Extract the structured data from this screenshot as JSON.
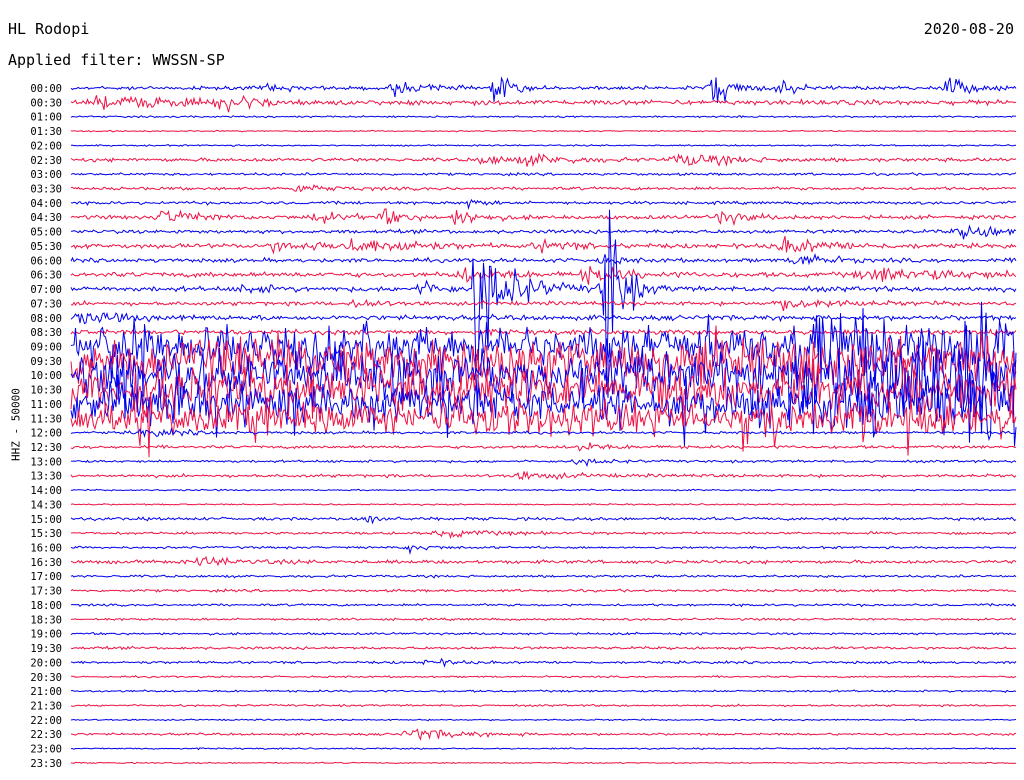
{
  "header": {
    "station": "HL Rodopi",
    "date": "2020-08-20",
    "filter_prefix": "Applied filter:",
    "filter_name": "WWSSN-SP"
  },
  "channel_label": "HHZ - 50000",
  "colors": {
    "odd_trace": "#0000ee",
    "even_trace": "#ee1144",
    "text": "#000000",
    "background": "#ffffff"
  },
  "chart_data": {
    "type": "line",
    "title": "",
    "xlabel": "",
    "ylabel": "HHZ - 50000",
    "grid": false,
    "legend": "none",
    "y_tick_labels": [
      "00:00",
      "00:30",
      "01:00",
      "01:30",
      "02:00",
      "02:30",
      "03:00",
      "03:30",
      "04:00",
      "04:30",
      "05:00",
      "05:30",
      "06:00",
      "06:30",
      "07:00",
      "07:30",
      "08:00",
      "08:30",
      "09:00",
      "09:30",
      "10:00",
      "10:30",
      "11:00",
      "11:30",
      "12:00",
      "12:30",
      "13:00",
      "13:30",
      "14:00",
      "14:30",
      "15:00",
      "15:30",
      "16:00",
      "16:30",
      "17:00",
      "17:30",
      "18:00",
      "18:30",
      "19:00",
      "19:30",
      "20:00",
      "20:30",
      "21:00",
      "21:30",
      "22:00",
      "22:30",
      "23:00",
      "23:30"
    ],
    "x_unit": "fraction of 30-minute row",
    "noise_level": [
      1.5,
      2,
      0.7,
      0.5,
      0.6,
      1.5,
      1,
      1.2,
      1.2,
      1.6,
      1.5,
      1.8,
      1.6,
      2,
      2,
      1.6,
      2,
      2,
      3,
      6,
      6,
      5,
      3,
      1.5,
      1,
      1.2,
      1,
      1.2,
      0.6,
      0.6,
      1.2,
      1,
      0.9,
      1.4,
      1,
      1,
      0.9,
      0.9,
      0.9,
      1.1,
      1,
      0.7,
      0.8,
      0.8,
      0.6,
      0.9,
      0.6,
      0.5
    ],
    "events": [
      {
        "row": 0,
        "x": 0.21,
        "amp": 3,
        "width": 0.008
      },
      {
        "row": 0,
        "x": 0.34,
        "amp": 8,
        "width": 0.006
      },
      {
        "row": 0,
        "x": 0.38,
        "amp": 4,
        "width": 0.005
      },
      {
        "row": 0,
        "x": 0.45,
        "amp": 15,
        "width": 0.006
      },
      {
        "row": 0,
        "x": 0.68,
        "amp": 17,
        "width": 0.008
      },
      {
        "row": 0,
        "x": 0.75,
        "amp": 7,
        "width": 0.006
      },
      {
        "row": 0,
        "x": 0.93,
        "amp": 10,
        "width": 0.008
      },
      {
        "row": 1,
        "x": 0.03,
        "amp": 5,
        "width": 0.01
      },
      {
        "row": 1,
        "x": 0.07,
        "amp": 4,
        "width": 0.02
      },
      {
        "row": 1,
        "x": 0.163,
        "amp": 12,
        "width": 0.01
      },
      {
        "row": 5,
        "x": 0.44,
        "amp": 3,
        "width": 0.02
      },
      {
        "row": 5,
        "x": 0.49,
        "amp": 4,
        "width": 0.015
      },
      {
        "row": 5,
        "x": 0.65,
        "amp": 5,
        "width": 0.02
      },
      {
        "row": 7,
        "x": 0.24,
        "amp": 3,
        "width": 0.015
      },
      {
        "row": 8,
        "x": 0.42,
        "amp": 4,
        "width": 0.006
      },
      {
        "row": 9,
        "x": 0.1,
        "amp": 6,
        "width": 0.015
      },
      {
        "row": 9,
        "x": 0.26,
        "amp": 5,
        "width": 0.01
      },
      {
        "row": 9,
        "x": 0.33,
        "amp": 6,
        "width": 0.01
      },
      {
        "row": 9,
        "x": 0.41,
        "amp": 7,
        "width": 0.01
      },
      {
        "row": 9,
        "x": 0.689,
        "amp": 6,
        "width": 0.01
      },
      {
        "row": 10,
        "x": 0.95,
        "amp": 5,
        "width": 0.02
      },
      {
        "row": 11,
        "x": 0.22,
        "amp": 4,
        "width": 0.02
      },
      {
        "row": 11,
        "x": 0.3,
        "amp": 5,
        "width": 0.02
      },
      {
        "row": 11,
        "x": 0.35,
        "amp": 4,
        "width": 0.01
      },
      {
        "row": 11,
        "x": 0.5,
        "amp": 4,
        "width": 0.015
      },
      {
        "row": 11,
        "x": 0.76,
        "amp": 6,
        "width": 0.02
      },
      {
        "row": 12,
        "x": 0.56,
        "amp": 3,
        "width": 0.01
      },
      {
        "row": 12,
        "x": 0.77,
        "amp": 6,
        "width": 0.012
      },
      {
        "row": 13,
        "x": 0.42,
        "amp": 6,
        "width": 0.015
      },
      {
        "row": 13,
        "x": 0.55,
        "amp": 7,
        "width": 0.015
      },
      {
        "row": 13,
        "x": 0.86,
        "amp": 5,
        "width": 0.04
      },
      {
        "row": 14,
        "x": 0.43,
        "amp": 105,
        "width": 0.006
      },
      {
        "row": 14,
        "x": 0.473,
        "amp": 10,
        "width": 0.015
      },
      {
        "row": 14,
        "x": 0.565,
        "amp": 115,
        "width": 0.006
      },
      {
        "row": 14,
        "x": 0.185,
        "amp": 4,
        "width": 0.01
      },
      {
        "row": 14,
        "x": 0.37,
        "amp": 6,
        "width": 0.01
      },
      {
        "row": 15,
        "x": 0.3,
        "amp": 4,
        "width": 0.01
      },
      {
        "row": 15,
        "x": 0.76,
        "amp": 5,
        "width": 0.02
      },
      {
        "row": 16,
        "x": 0.01,
        "amp": 4,
        "width": 0.02
      },
      {
        "row": 18,
        "x": 0.555,
        "amp": 8,
        "width": 0.01
      },
      {
        "row": 19,
        "x": 0.4,
        "amp": 7,
        "width": 0.02
      },
      {
        "row": 22,
        "x": 0.05,
        "amp": 10,
        "width": 0.03
      },
      {
        "row": 22,
        "x": 0.93,
        "amp": 8,
        "width": 0.015
      },
      {
        "row": 24,
        "x": 0.08,
        "amp": 3,
        "width": 0.02
      },
      {
        "row": 25,
        "x": 0.54,
        "amp": 4,
        "width": 0.01
      },
      {
        "row": 26,
        "x": 0.54,
        "amp": 3,
        "width": 0.01
      },
      {
        "row": 27,
        "x": 0.48,
        "amp": 3,
        "width": 0.02
      },
      {
        "row": 30,
        "x": 0.31,
        "amp": 4,
        "width": 0.008
      },
      {
        "row": 31,
        "x": 0.4,
        "amp": 3,
        "width": 0.02
      },
      {
        "row": 32,
        "x": 0.36,
        "amp": 3,
        "width": 0.01
      },
      {
        "row": 33,
        "x": 0.14,
        "amp": 3,
        "width": 0.02
      },
      {
        "row": 40,
        "x": 0.38,
        "amp": 3,
        "width": 0.01
      },
      {
        "row": 45,
        "x": 0.364,
        "amp": 5,
        "width": 0.02
      }
    ],
    "storm": {
      "rows": [
        18,
        19,
        20,
        21,
        22,
        23
      ],
      "x_start": 0.0,
      "x_end": 1.0,
      "amp": 18
    },
    "microseism": {
      "rows": [
        18,
        19,
        20,
        21,
        22,
        23
      ],
      "x_start": 0.76,
      "x_end": 1.0,
      "amp": 22
    }
  }
}
